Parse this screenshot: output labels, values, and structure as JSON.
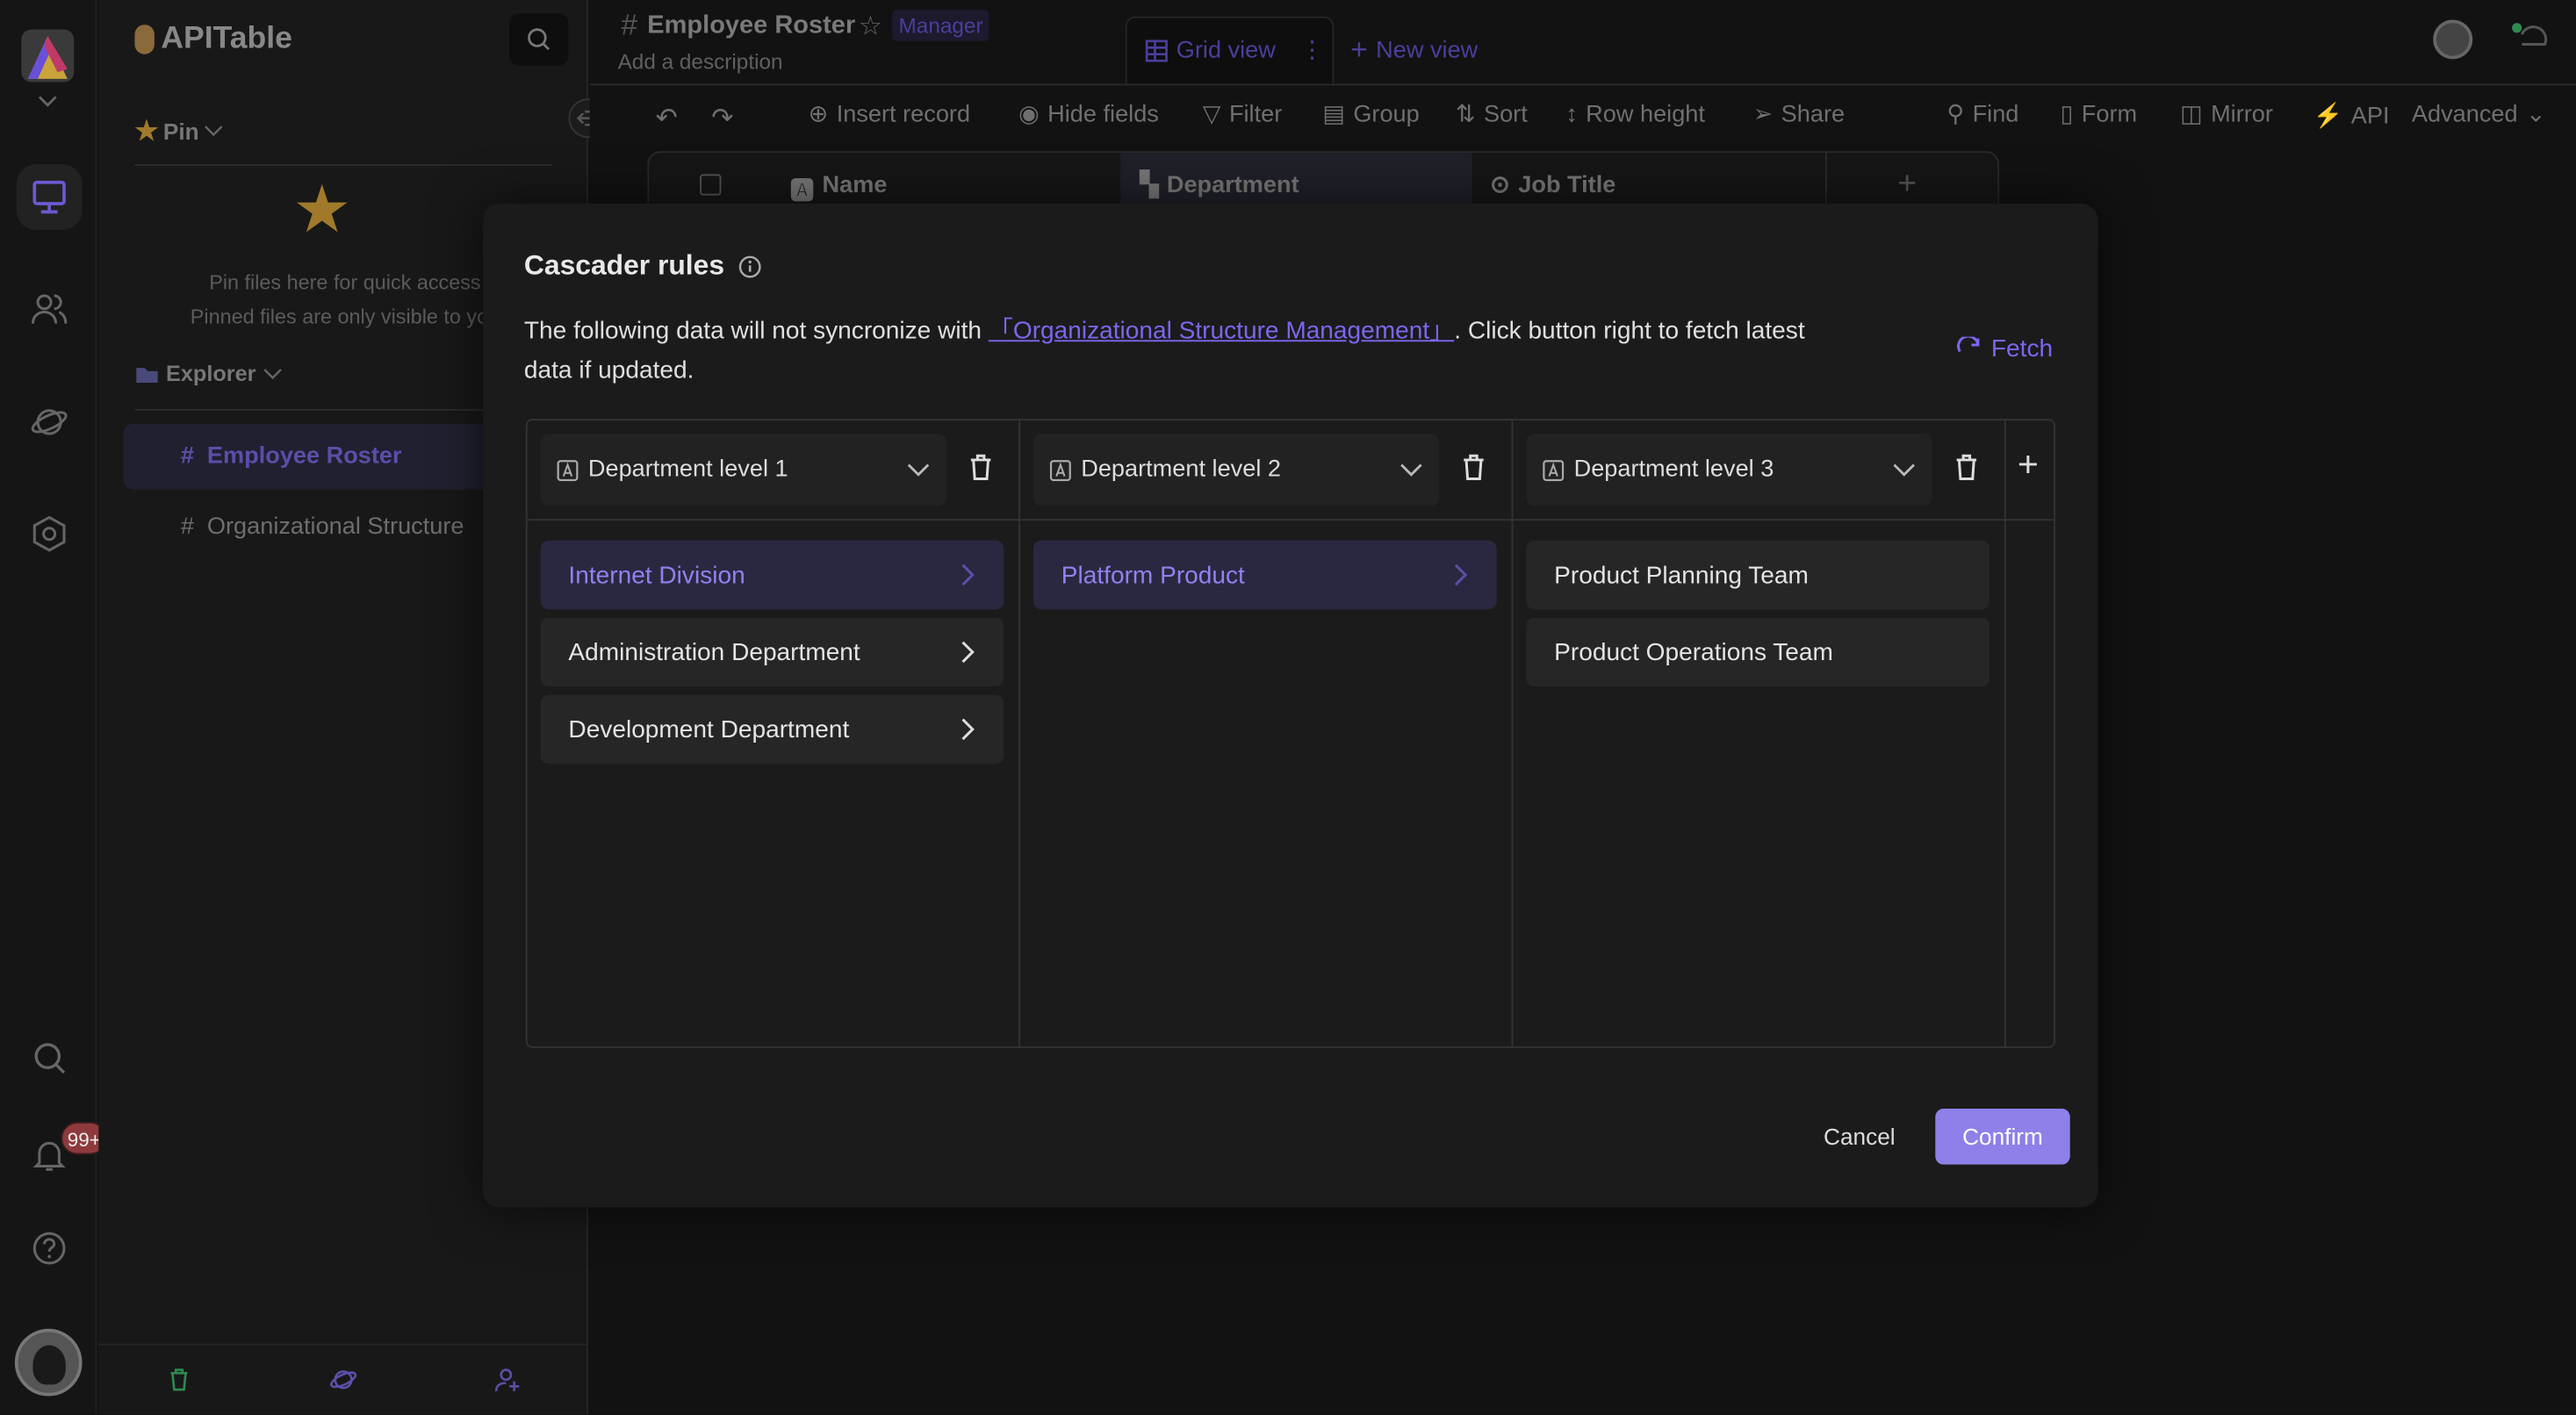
{
  "colors": {
    "accent": "#7b67ee",
    "confirm_bg": "#8d80e8",
    "badge": "#c0474a"
  },
  "rail": {
    "badge": "99+",
    "icons": [
      "workbench-icon",
      "members-icon",
      "planet-icon",
      "settings-icon",
      "search-icon",
      "bell-icon",
      "help-icon"
    ]
  },
  "sidebar": {
    "app_name": "APITable",
    "pin_label": "Pin",
    "pin_hint1": "Pin files here for quick access",
    "pin_hint2": "Pinned files are only visible to you",
    "explorer_label": "Explorer",
    "files": [
      {
        "label": "Employee Roster",
        "active": true
      },
      {
        "label": "Organizational Structure",
        "active": false
      }
    ]
  },
  "header": {
    "title": "Employee Roster",
    "role_badge": "Manager",
    "description": "Add a description",
    "tabs": {
      "grid_view": "Grid view",
      "new_view": "New view"
    }
  },
  "toolbar": {
    "insert_record": "Insert record",
    "hide_fields": "Hide fields",
    "filter": "Filter",
    "group": "Group",
    "sort": "Sort",
    "row_height": "Row height",
    "share": "Share",
    "find": "Find",
    "form": "Form",
    "mirror": "Mirror",
    "api": "API",
    "advanced": "Advanced"
  },
  "grid": {
    "columns": [
      "Name",
      "Department",
      "Job Title"
    ]
  },
  "modal": {
    "title": "Cascader rules",
    "desc_before": "The following data will not syncronize with ",
    "desc_link": "「Organizational Structure Management」",
    "desc_after": ". Click button right to fetch latest data if updated.",
    "fetch": "Fetch",
    "levels": [
      {
        "field": "Department level 1",
        "items": [
          {
            "label": "Internet Division",
            "selected": true,
            "has_children": true
          },
          {
            "label": "Administration Department",
            "selected": false,
            "has_children": true
          },
          {
            "label": "Development Department",
            "selected": false,
            "has_children": true
          }
        ]
      },
      {
        "field": "Department level 2",
        "items": [
          {
            "label": "Platform Product",
            "selected": true,
            "has_children": true
          }
        ]
      },
      {
        "field": "Department level 3",
        "items": [
          {
            "label": "Product Planning Team",
            "selected": false,
            "has_children": false
          },
          {
            "label": "Product Operations Team",
            "selected": false,
            "has_children": false
          }
        ]
      }
    ],
    "cancel": "Cancel",
    "confirm": "Confirm"
  }
}
